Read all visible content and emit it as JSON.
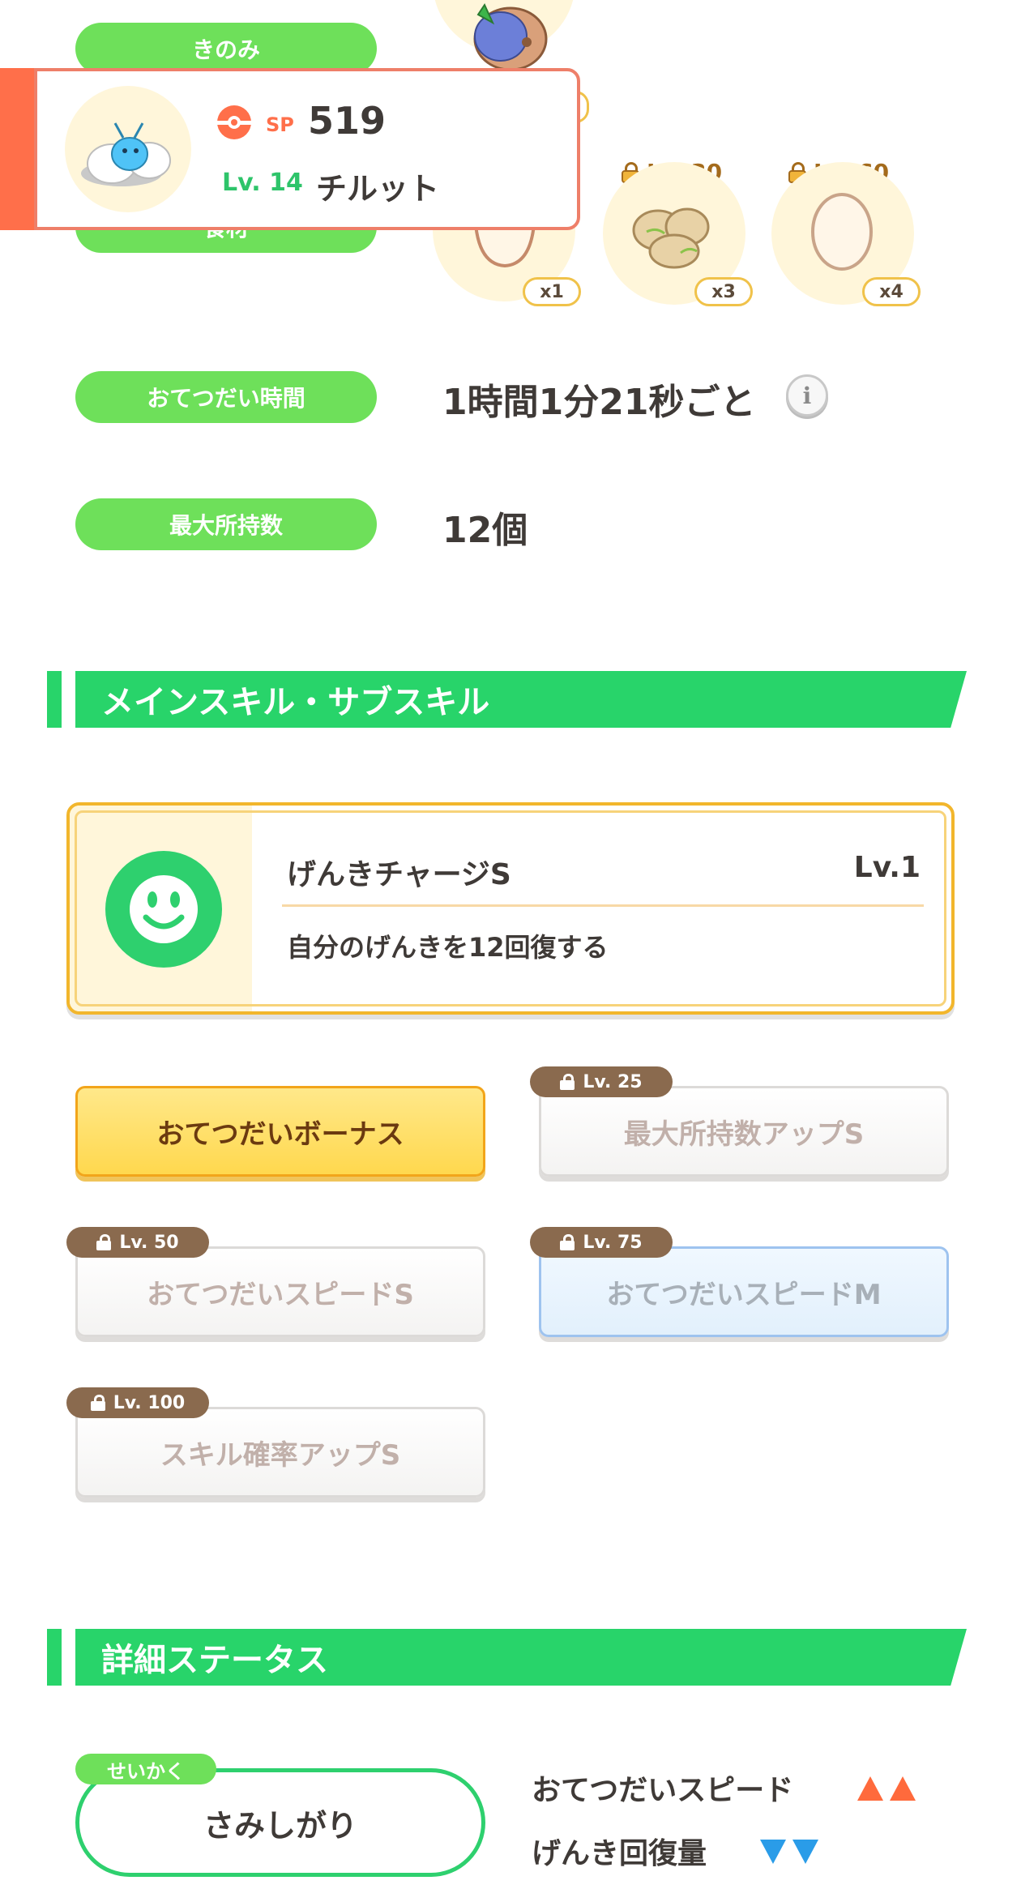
{
  "ingredients": {
    "top_label": "きのみ",
    "hidden_label": "食材",
    "quantities": [
      "x1",
      "x3",
      "x4"
    ],
    "unlock_levels": [
      "Lv. 30",
      "Lv. 60"
    ]
  },
  "help_time": {
    "label": "おてつだい時間",
    "value": "1時間1分21秒ごと"
  },
  "max_carry": {
    "label": "最大所持数",
    "value": "12個"
  },
  "profile_popup": {
    "sp_label": "SP",
    "sp_value": "519",
    "level": "Lv. 14",
    "name": "チルット"
  },
  "skills_section": {
    "title": "メインスキル・サブスキル",
    "main_skill": {
      "name": "げんきチャージS",
      "level": "Lv.1",
      "description": "自分のげんきを12回復する"
    },
    "sub_skills": [
      {
        "name": "おてつだいボーナス",
        "lock_level": "",
        "state": "active"
      },
      {
        "name": "最大所持数アップS",
        "lock_level": "Lv. 25",
        "state": "locked"
      },
      {
        "name": "おてつだいスピードS",
        "lock_level": "Lv. 50",
        "state": "locked"
      },
      {
        "name": "おてつだいスピードM",
        "lock_level": "Lv. 75",
        "state": "locked-blue"
      },
      {
        "name": "スキル確率アップS",
        "lock_level": "Lv. 100",
        "state": "locked"
      }
    ]
  },
  "status_section": {
    "title": "詳細ステータス",
    "nature_tag": "せいかく",
    "nature": "さみしがり",
    "effects": [
      {
        "label": "おてつだいスピード",
        "direction": "up"
      },
      {
        "label": "げんき回復量",
        "direction": "down"
      }
    ]
  },
  "colors": {
    "green_pill": "#6ee05a",
    "section_green": "#28d46a",
    "accent_orange": "#ff6f4a",
    "up_arrow": "#ff6a3c",
    "down_arrow": "#2a9ce8"
  }
}
